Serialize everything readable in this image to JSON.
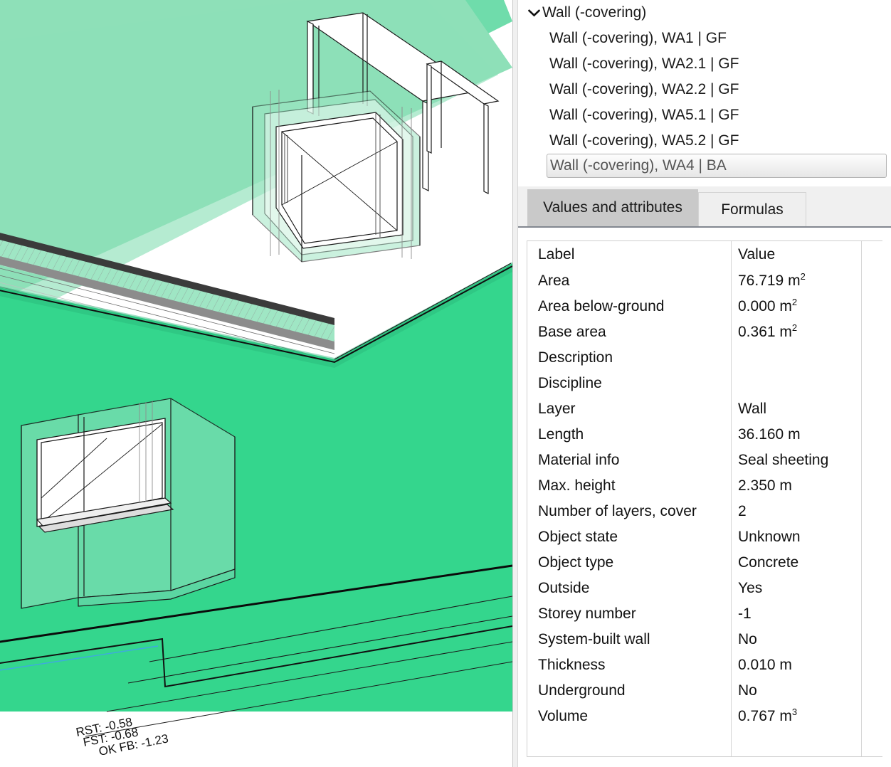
{
  "tree": {
    "root": {
      "label": "Wall (-covering)",
      "icon": "chevron-down-icon",
      "expanded": true
    },
    "items": [
      {
        "label": "Wall (-covering), WA1 | GF",
        "selected": false
      },
      {
        "label": "Wall (-covering), WA2.1 | GF",
        "selected": false
      },
      {
        "label": "Wall (-covering), WA2.2 | GF",
        "selected": false
      },
      {
        "label": "Wall (-covering), WA5.1 | GF",
        "selected": false
      },
      {
        "label": "Wall (-covering), WA5.2 | GF",
        "selected": false
      },
      {
        "label": "Wall (-covering), WA4 | BA",
        "selected": true
      }
    ]
  },
  "tabs": [
    {
      "label": "Values and attributes",
      "active": true
    },
    {
      "label": "Formulas",
      "active": false
    }
  ],
  "table": {
    "columns": [
      "Label",
      "Value"
    ],
    "rows": [
      {
        "label": "Area",
        "value": "76.719 m",
        "sup": "2"
      },
      {
        "label": "Area below-ground",
        "value": "0.000 m",
        "sup": "2"
      },
      {
        "label": "Base area",
        "value": "0.361 m",
        "sup": "2"
      },
      {
        "label": "Description",
        "value": "",
        "sup": ""
      },
      {
        "label": "Discipline",
        "value": "",
        "sup": ""
      },
      {
        "label": "Layer",
        "value": "Wall",
        "sup": ""
      },
      {
        "label": "Length",
        "value": "36.160 m",
        "sup": ""
      },
      {
        "label": "Material info",
        "value": "Seal sheeting",
        "sup": ""
      },
      {
        "label": "Max. height",
        "value": "2.350 m",
        "sup": ""
      },
      {
        "label": "Number of layers, cover",
        "value": "2",
        "sup": ""
      },
      {
        "label": "Object state",
        "value": "Unknown",
        "sup": ""
      },
      {
        "label": "Object type",
        "value": "Concrete",
        "sup": ""
      },
      {
        "label": "Outside",
        "value": "Yes",
        "sup": ""
      },
      {
        "label": "Storey number",
        "value": "-1",
        "sup": ""
      },
      {
        "label": "System-built wall",
        "value": "No",
        "sup": ""
      },
      {
        "label": "Thickness",
        "value": "0.010 m",
        "sup": ""
      },
      {
        "label": "Underground",
        "value": "No",
        "sup": ""
      },
      {
        "label": "Volume",
        "value": "0.767 m",
        "sup": "3"
      }
    ]
  },
  "viewport": {
    "annotations": [
      {
        "text": "RST:  -0.58"
      },
      {
        "text": "FST:  -0.68"
      },
      {
        "text": "OK FB: -1.23"
      }
    ],
    "colors": {
      "selection_light": "#8EE0B8",
      "selection_mid": "#6FDCAB",
      "selection_strong": "#34D68D",
      "selection_deep": "#2ECC87",
      "edge": "#111111",
      "edge_soft": "#7a7a7a",
      "background": "#FFFFFF",
      "guide_blue": "#4FA8E8"
    }
  },
  "panel": {
    "colors": {
      "tab_active_bg": "#C9C9C9",
      "tab_inactive_bg": "#EFEFEF",
      "strip_bg": "#F0F0F0",
      "divider": "#828790",
      "selected_row_text": "#555555"
    }
  }
}
